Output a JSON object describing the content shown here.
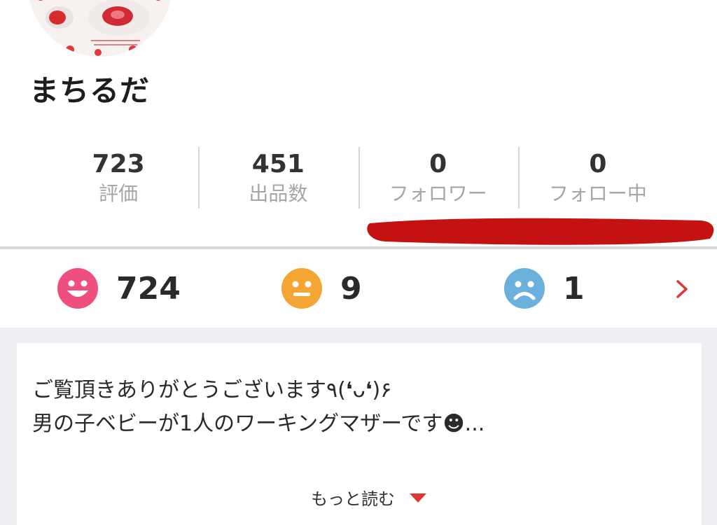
{
  "profile": {
    "username": "まちるだ",
    "avatar_alt": "strawberry-daifuku-photo"
  },
  "stats": [
    {
      "value": "723",
      "label": "評価"
    },
    {
      "value": "451",
      "label": "出品数"
    },
    {
      "value": "0",
      "label": "フォロワー"
    },
    {
      "value": "0",
      "label": "フォロー中"
    }
  ],
  "ratings": {
    "good": "724",
    "normal": "9",
    "bad": "1"
  },
  "bio": {
    "line1": "ご覧頂きありがとうございます٩(❛ᴗ❛)۶",
    "line2": "男の子ベビーが1人のワーキングマザーです☻...",
    "read_more": "もっと読む"
  },
  "colors": {
    "good": "#ef4f7f",
    "normal": "#f4a533",
    "bad": "#6cb1dc",
    "accent_red": "#e13434",
    "redaction": "#c41212"
  }
}
